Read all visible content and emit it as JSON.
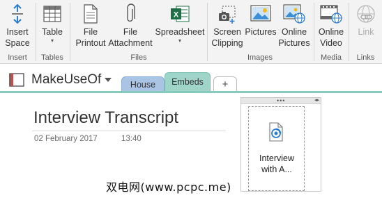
{
  "ribbon": {
    "groups": {
      "insert": "Insert",
      "tables": "Tables",
      "files": "Files",
      "images": "Images",
      "media": "Media",
      "links": "Links"
    },
    "buttons": {
      "insert_space": "Insert\nSpace",
      "table": "Table",
      "file_printout": "File\nPrintout",
      "file_attachment": "File\nAttachment",
      "spreadsheet": "Spreadsheet",
      "screen_clipping": "Screen\nClipping",
      "pictures": "Pictures",
      "online_pictures": "Online\nPictures",
      "online_video": "Online\nVideo",
      "link": "Link"
    }
  },
  "notebook": {
    "name": "MakeUseOf",
    "sections": [
      "House",
      "Embeds"
    ],
    "add_label": "+"
  },
  "page": {
    "title": "Interview Transcript",
    "date": "02 February 2017",
    "time": "13:40"
  },
  "attachment": {
    "name": "Interview\nwith A..."
  },
  "watermark": "双电网(www.pcpc.me)",
  "colors": {
    "house_tab": "#a9c4e4",
    "embeds_tab": "#9fd4c9",
    "excel_green": "#1e7145",
    "accent_blue": "#2b7cd3"
  }
}
